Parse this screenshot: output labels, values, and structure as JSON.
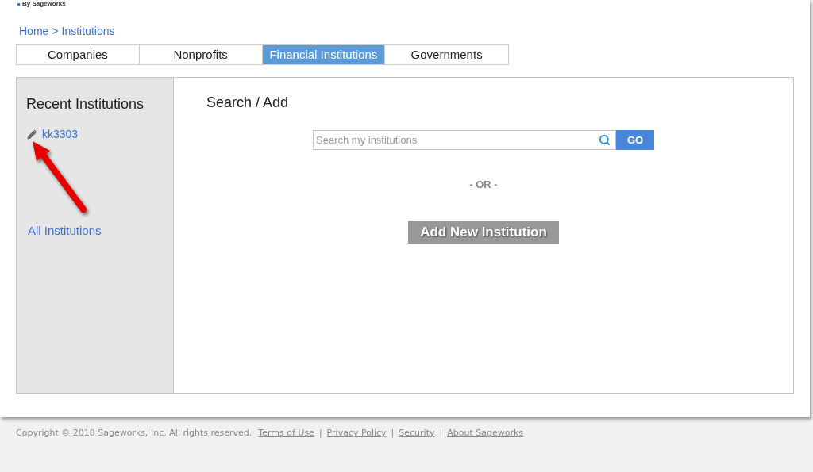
{
  "logo": {
    "text": "By Sageworks"
  },
  "breadcrumb": {
    "items": [
      "Home",
      "Institutions"
    ],
    "separator": ">"
  },
  "tabs": [
    {
      "label": "Companies",
      "selected": false
    },
    {
      "label": "Nonprofits",
      "selected": false
    },
    {
      "label": "Financial Institutions",
      "selected": true
    },
    {
      "label": "Governments",
      "selected": false
    }
  ],
  "sidebar": {
    "title": "Recent Institutions",
    "recent": [
      {
        "label": "kk3303"
      }
    ],
    "all_link": "All Institutions"
  },
  "main": {
    "title": "Search / Add",
    "search": {
      "placeholder": "Search my institutions",
      "button": "GO"
    },
    "divider": "- OR -",
    "add_button": "Add New Institution"
  },
  "footer": {
    "copyright": "Copyright © 2018 Sageworks, Inc. All rights reserved.",
    "links": [
      {
        "label": "Terms of Use"
      },
      {
        "label": "Privacy Policy",
        "separator": "|"
      },
      {
        "label": "Security",
        "separator": "|"
      },
      {
        "label": "About Sageworks",
        "separator": "|"
      }
    ]
  }
}
